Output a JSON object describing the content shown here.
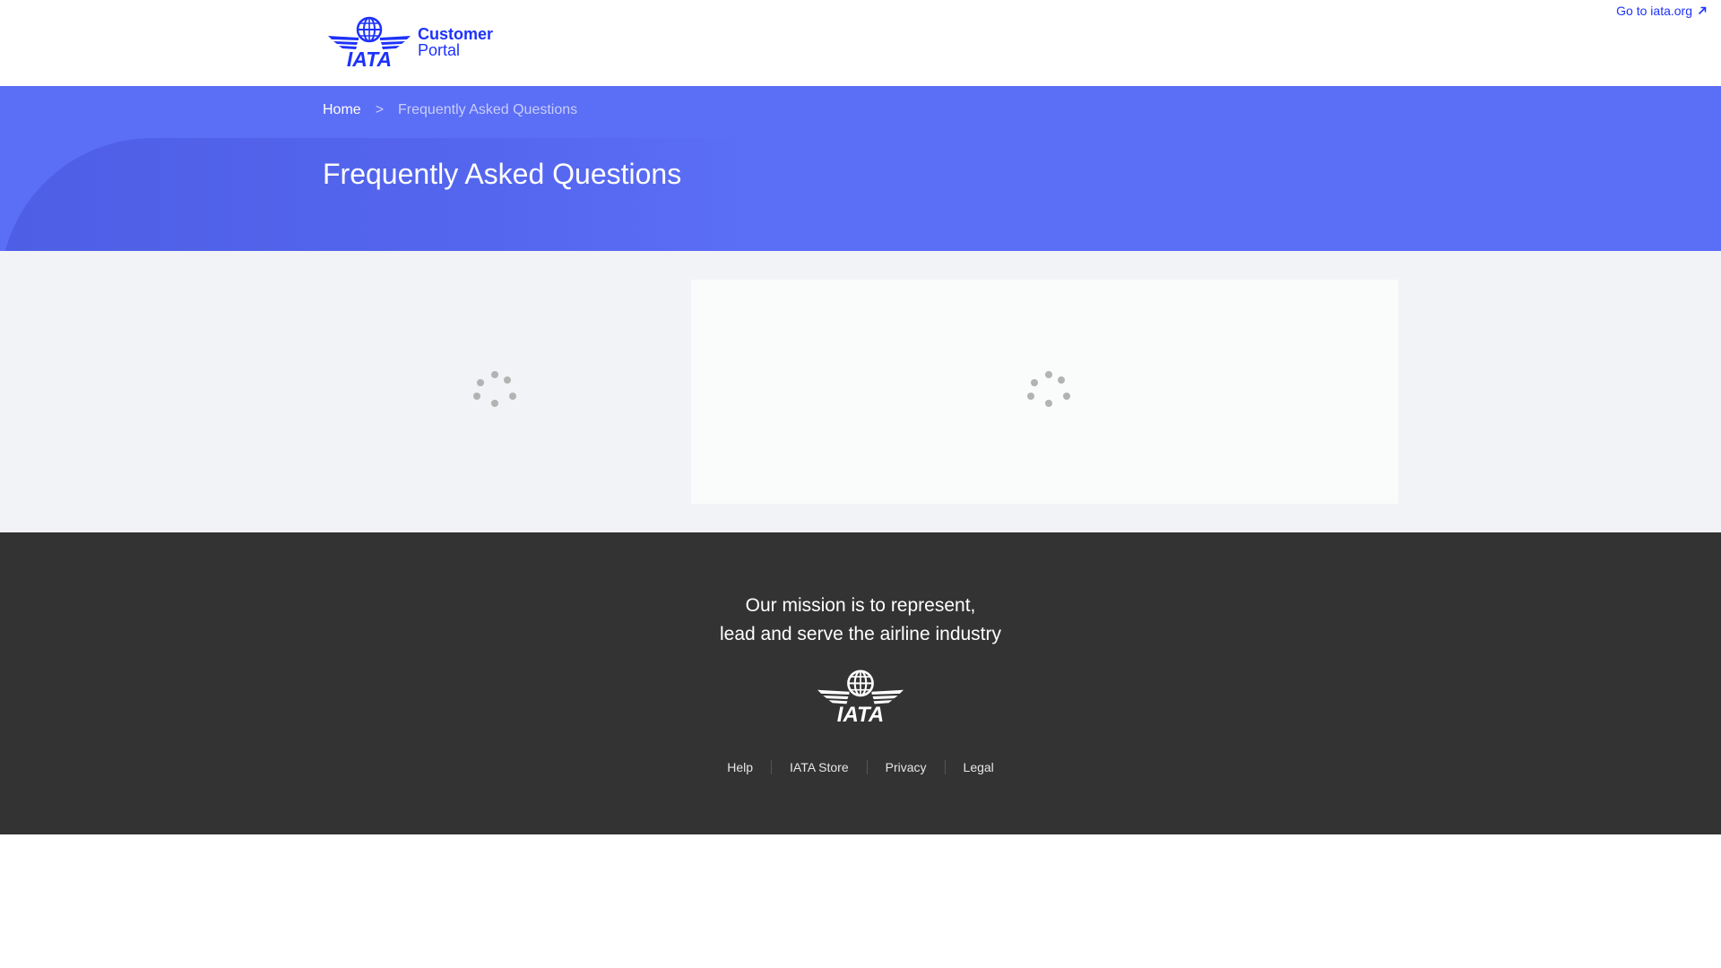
{
  "header": {
    "logo_wordmark": "IATA",
    "logo_line1": "Customer",
    "logo_line2": "Portal",
    "goto_link": "Go to iata.org",
    "goto_icon": "external-arrow-icon"
  },
  "hero": {
    "breadcrumb": {
      "home": "Home",
      "separator": ">",
      "current": "Frequently Asked Questions"
    },
    "title": "Frequently Asked Questions"
  },
  "content": {
    "left_spinner": "loading-spinner-icon",
    "right_spinner": "loading-spinner-icon"
  },
  "footer": {
    "mission_line1": "Our mission is to represent,",
    "mission_line2": "lead and serve the airline industry",
    "logo_wordmark": "IATA",
    "links": [
      "Help",
      "IATA Store",
      "Privacy",
      "Legal"
    ]
  },
  "colors": {
    "brand_blue": "#1e32fa",
    "hero_bg": "#5b6ef6",
    "content_bg": "#f2f3f7",
    "footer_bg": "#333333"
  }
}
